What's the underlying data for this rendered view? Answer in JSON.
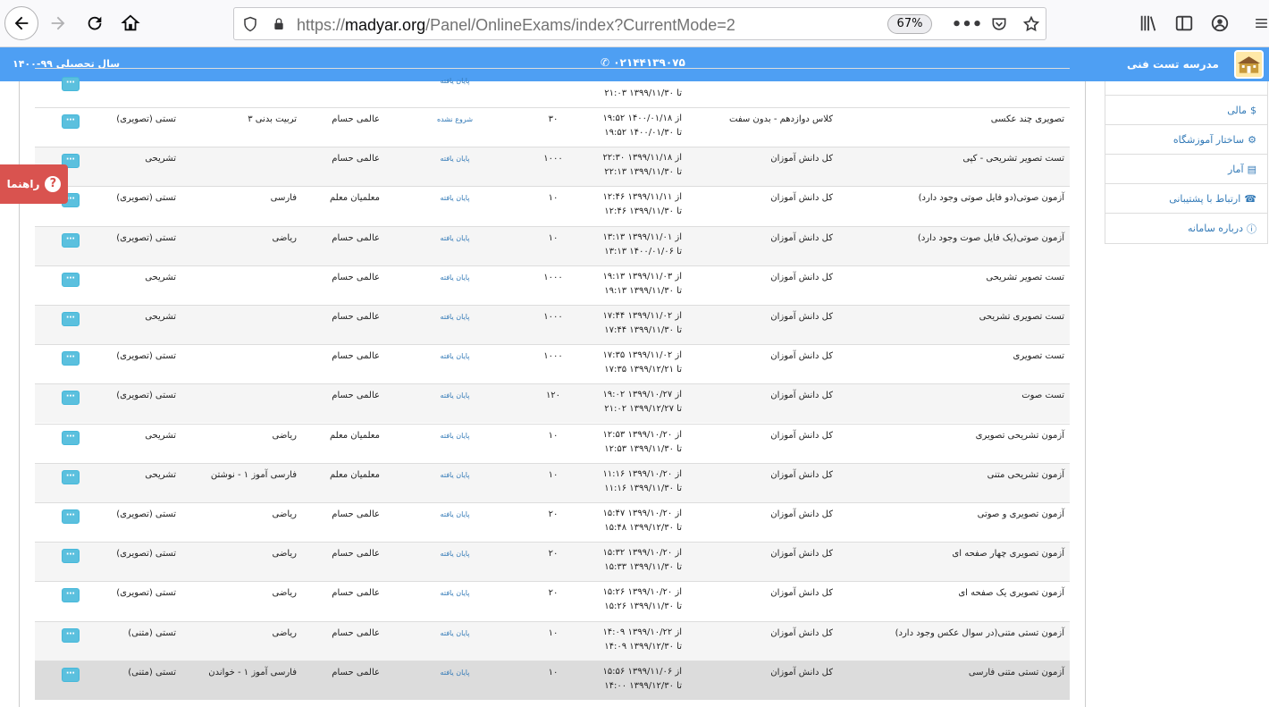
{
  "browser": {
    "url_prefix": "https://",
    "url_domain": "madyar.org",
    "url_path": "/Panel/OnlineExams/index?CurrentMode=2",
    "zoom": "67%"
  },
  "header": {
    "school_name": "مدرسه تست فنی",
    "phone": "۰۲۱۴۴۱۳۹۰۷۵",
    "year": "سال تحصیلی ۹۹-۱۴۰۰"
  },
  "sidebar": {
    "items": [
      {
        "label": "مالی",
        "icon": "dollar-icon"
      },
      {
        "label": "ساختار آموزشگاه",
        "icon": "gear-icon"
      },
      {
        "label": "آمار",
        "icon": "chart-icon"
      },
      {
        "label": "ارتباط با پشتیبانی",
        "icon": "phone-icon"
      },
      {
        "label": "درباره سامانه",
        "icon": "info-icon"
      }
    ]
  },
  "help": {
    "label": "راهنما"
  },
  "table": {
    "rows": [
      {
        "title": "تصویری چند عکسی",
        "target": "کلاس دوازدهم - بدون سفت",
        "from": "از ۱۴۰۰/۰۱/۱۸ ۱۹:۵۲",
        "to": "تا ۱۴۰۰/۰۱/۳۰ ۱۹:۵۲",
        "score": "۳۰",
        "status": "شروع نشده",
        "teacher": "عالمی حسام",
        "course": "تربیت بدنی ۳",
        "type": "تستی (تصویری)"
      },
      {
        "title": "تست تصویر تشریحی - کپی",
        "target": "کل دانش آموزان",
        "from": "از ۱۳۹۹/۱۱/۱۸ ۲۲:۳۰",
        "to": "تا ۱۳۹۹/۱۱/۳۰ ۲۲:۱۳",
        "score": "۱۰۰۰",
        "status": "پایان یافته",
        "teacher": "عالمی حسام",
        "course": "",
        "type": "تشریحی"
      },
      {
        "title": "آزمون صوتی(دو فایل صوتی وجود دارد)",
        "target": "کل دانش آموزان",
        "from": "از ۱۳۹۹/۱۱/۱۱ ۱۲:۴۶",
        "to": "تا ۱۳۹۹/۱۱/۳۰ ۱۲:۴۶",
        "score": "۱۰",
        "status": "پایان یافته",
        "teacher": "معلمیان معلم",
        "course": "فارسی",
        "type": "تستی (تصویری)"
      },
      {
        "title": "آزمون صوتی(یک فایل صوت وجود دارد)",
        "target": "کل دانش آموزان",
        "from": "از ۱۳۹۹/۱۱/۰۱ ۱۳:۱۳",
        "to": "تا ۱۴۰۰/۰۱/۰۶ ۱۳:۱۳",
        "score": "۱۰",
        "status": "پایان یافته",
        "teacher": "عالمی حسام",
        "course": "ریاضی",
        "type": "تستی (تصویری)"
      },
      {
        "title": "تست تصویر تشریحی",
        "target": "کل دانش آموزان",
        "from": "از ۱۳۹۹/۱۱/۰۳ ۱۹:۱۳",
        "to": "تا ۱۳۹۹/۱۱/۳۰ ۱۹:۱۳",
        "score": "۱۰۰۰",
        "status": "پایان یافته",
        "teacher": "عالمی حسام",
        "course": "",
        "type": "تشریحی"
      },
      {
        "title": "تست تصویری تشریحی",
        "target": "کل دانش آموزان",
        "from": "از ۱۳۹۹/۱۱/۰۲ ۱۷:۴۴",
        "to": "تا ۱۳۹۹/۱۱/۳۰ ۱۷:۴۴",
        "score": "۱۰۰۰",
        "status": "پایان یافته",
        "teacher": "عالمی حسام",
        "course": "",
        "type": "تشریحی"
      },
      {
        "title": "تست تصویری",
        "target": "کل دانش آموزان",
        "from": "از ۱۳۹۹/۱۱/۰۲ ۱۷:۳۵",
        "to": "تا ۱۳۹۹/۱۲/۲۱ ۱۷:۳۵",
        "score": "۱۰۰۰",
        "status": "پایان یافته",
        "teacher": "عالمی حسام",
        "course": "",
        "type": "تستی (تصویری)"
      },
      {
        "title": "تست صوت",
        "target": "کل دانش آموزان",
        "from": "از ۱۳۹۹/۱۰/۲۷ ۱۹:۰۲",
        "to": "تا ۱۳۹۹/۱۲/۲۷ ۲۱:۰۲",
        "score": "۱۲۰",
        "status": "پایان یافته",
        "teacher": "عالمی حسام",
        "course": "",
        "type": "تستی (تصویری)"
      },
      {
        "title": "آزمون تشریحی تصویری",
        "target": "کل دانش آموزان",
        "from": "از ۱۳۹۹/۱۰/۲۰ ۱۲:۵۳",
        "to": "تا ۱۳۹۹/۱۱/۳۰ ۱۲:۵۳",
        "score": "۱۰",
        "status": "پایان یافته",
        "teacher": "معلمیان معلم",
        "course": "ریاضی",
        "type": "تشریحی"
      },
      {
        "title": "آزمون تشریحی متنی",
        "target": "کل دانش آموزان",
        "from": "از ۱۳۹۹/۱۰/۲۰ ۱۱:۱۶",
        "to": "تا ۱۳۹۹/۱۱/۳۰ ۱۱:۱۶",
        "score": "۱۰",
        "status": "پایان یافته",
        "teacher": "معلمیان معلم",
        "course": "فارسی آموز ۱ - نوشتن",
        "type": "تشریحی"
      },
      {
        "title": "آزمون تصویری و صوتی",
        "target": "کل دانش آموزان",
        "from": "از ۱۳۹۹/۱۰/۲۰ ۱۵:۴۷",
        "to": "تا ۱۳۹۹/۱۲/۳۰ ۱۵:۴۸",
        "score": "۲۰",
        "status": "پایان یافته",
        "teacher": "عالمی حسام",
        "course": "ریاضی",
        "type": "تستی (تصویری)"
      },
      {
        "title": "آزمون تصویری چهار صفحه ای",
        "target": "کل دانش آموزان",
        "from": "از ۱۳۹۹/۱۰/۲۰ ۱۵:۳۲",
        "to": "تا ۱۳۹۹/۱۱/۳۰ ۱۵:۳۳",
        "score": "۲۰",
        "status": "پایان یافته",
        "teacher": "عالمی حسام",
        "course": "ریاضی",
        "type": "تستی (تصویری)"
      },
      {
        "title": "آزمون تصویری یک صفحه ای",
        "target": "کل دانش آموزان",
        "from": "از ۱۳۹۹/۱۰/۲۰ ۱۵:۲۶",
        "to": "تا ۱۳۹۹/۱۱/۳۰ ۱۵:۲۶",
        "score": "۲۰",
        "status": "پایان یافته",
        "teacher": "عالمی حسام",
        "course": "ریاضی",
        "type": "تستی (تصویری)"
      },
      {
        "title": "آزمون تستی متنی(در سوال عکس وجود دارد)",
        "target": "کل دانش آموزان",
        "from": "از ۱۳۹۹/۱۰/۲۲ ۱۴:۰۹",
        "to": "تا ۱۳۹۹/۱۲/۳۰ ۱۴:۰۹",
        "score": "۱۰",
        "status": "پایان یافته",
        "teacher": "عالمی حسام",
        "course": "ریاضی",
        "type": "تستی (متنی)"
      },
      {
        "title": "آزمون تستی متنی فارسی",
        "target": "کل دانش آموزان",
        "from": "از ۱۳۹۹/۱۱/۰۶ ۱۵:۵۶",
        "to": "تا ۱۳۹۹/۱۲/۳۰ ۱۴:۰۰",
        "score": "۱۰",
        "status": "پایان یافته",
        "teacher": "عالمی حسام",
        "course": "فارسی آموز ۱ - خواندن",
        "type": "تستی (متنی)"
      }
    ],
    "partial_top_row": {
      "to": "تا ۱۳۹۹/۱۱/۳۰ ۲۱:۰۳",
      "status": "پایان یافته"
    }
  }
}
